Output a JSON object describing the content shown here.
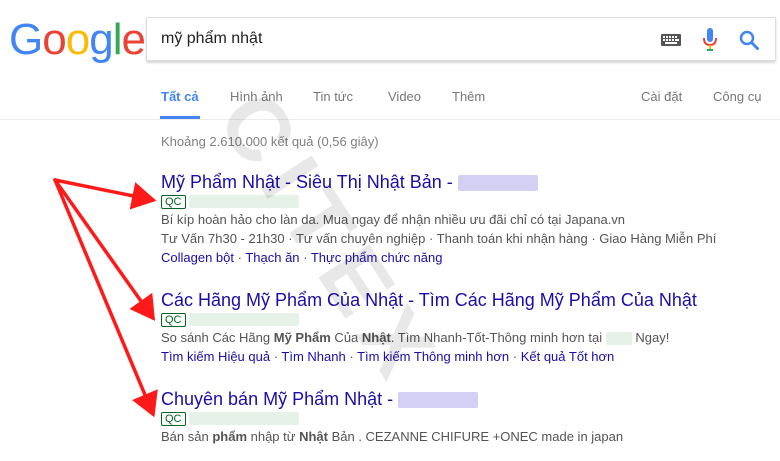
{
  "logo": {
    "letters": [
      "G",
      "o",
      "o",
      "g",
      "l",
      "e"
    ]
  },
  "search": {
    "query": "mỹ phẩm nhật"
  },
  "tabs": [
    {
      "label": "Tất cả",
      "active": true
    },
    {
      "label": "Hình ảnh"
    },
    {
      "label": "Tin tức"
    },
    {
      "label": "Video"
    },
    {
      "label": "Thêm"
    }
  ],
  "tools": {
    "settings": "Cài đặt",
    "tools": "Công cụ"
  },
  "stats": "Khoảng 2.610.000 kết quả (0,56 giây)",
  "badge": "QC",
  "ads": [
    {
      "title": "Mỹ Phẩm Nhật - Siêu Thị Nhật Bản -",
      "desc1": "Bí kíp hoàn hảo cho làn da. Mua ngay để nhận nhiều ưu đãi chỉ có tại Japana.vn",
      "desc2": "Tư Vấn 7h30 - 21h30 · Tư vấn chuyên nghiệp · Thanh toán khi nhận hàng · Giao Hàng Miễn Phí",
      "sitelinks": [
        "Collagen bột",
        "Thạch ăn",
        "Thực phẩm chức năng"
      ]
    },
    {
      "title": "Các Hãng Mỹ Phẩm Của Nhật - Tìm Các Hãng Mỹ Phẩm Của Nhật",
      "desc_parts": [
        "So sánh Các Hãng ",
        "Mỹ Phẩm",
        " Của ",
        "Nhật",
        ". Tìm Nhanh-Tốt-Thông minh hơn tại",
        " Ngay!"
      ],
      "sitelinks": [
        "Tìm kiếm Hiệu quả",
        "Tìm Nhanh",
        "Tìm kiếm Thông minh hơn",
        "Kết quả Tốt hơn"
      ]
    },
    {
      "title": "Chuyên bán Mỹ Phẩm Nhật -",
      "desc_parts": [
        "Bán sản ",
        "phẩm",
        " nhập từ ",
        "Nhật",
        " Bản . CEZANNE CHIFURE +ONEC made in japan"
      ]
    }
  ],
  "watermark": "CITEX",
  "colors": {
    "link": "#1a0dab",
    "url": "#006621",
    "accent": "#4285f4",
    "arrow": "#ff1a1a"
  }
}
